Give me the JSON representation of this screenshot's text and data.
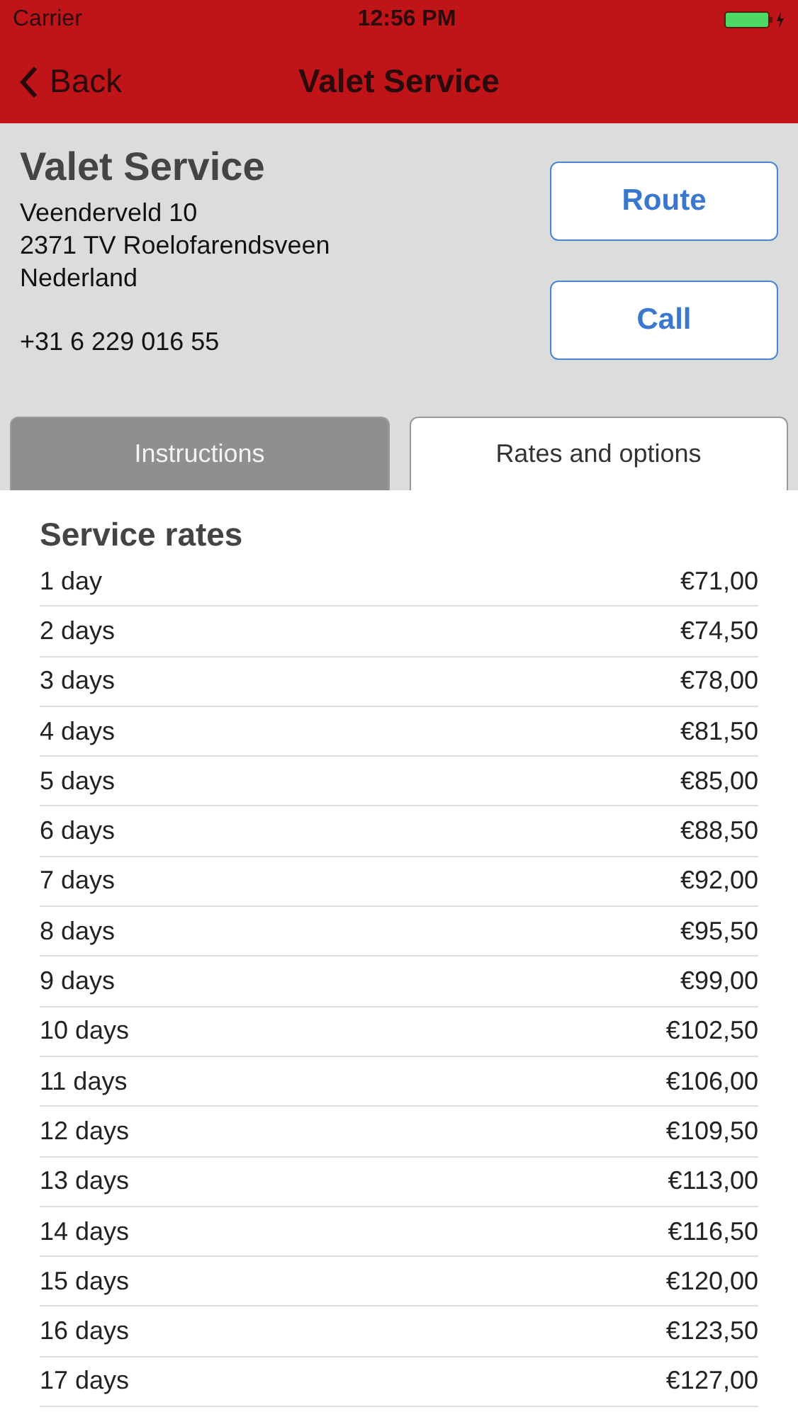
{
  "status_bar": {
    "carrier": "Carrier",
    "time": "12:56 PM"
  },
  "nav_bar": {
    "back": "Back",
    "title": "Valet Service"
  },
  "location": {
    "name": "Valet Service",
    "address": [
      "Veenderveld 10",
      "2371 TV Roelofarendsveen",
      "Nederland"
    ],
    "phone": "+31 6 229 016 55",
    "buttons": [
      "Route",
      "Call"
    ]
  },
  "tabs": [
    {
      "label": "Instructions",
      "selected": false
    },
    {
      "label": "Rates and options",
      "selected": true
    }
  ],
  "rates": {
    "title": "Service rates",
    "rows": [
      {
        "duration": "1 day",
        "price": "€71,00"
      },
      {
        "duration": "2 days",
        "price": "€74,50"
      },
      {
        "duration": "3 days",
        "price": "€78,00"
      },
      {
        "duration": "4 days",
        "price": "€81,50"
      },
      {
        "duration": "5 days",
        "price": "€85,00"
      },
      {
        "duration": "6 days",
        "price": "€88,50"
      },
      {
        "duration": "7 days",
        "price": "€92,00"
      },
      {
        "duration": "8 days",
        "price": "€95,50"
      },
      {
        "duration": "9 days",
        "price": "€99,00"
      },
      {
        "duration": "10 days",
        "price": "€102,50"
      },
      {
        "duration": "11 days",
        "price": "€106,00"
      },
      {
        "duration": "12 days",
        "price": "€109,50"
      },
      {
        "duration": "13 days",
        "price": "€113,00"
      },
      {
        "duration": "14 days",
        "price": "€116,50"
      },
      {
        "duration": "15 days",
        "price": "€120,00"
      },
      {
        "duration": "16 days",
        "price": "€123,50"
      },
      {
        "duration": "17 days",
        "price": "€127,00"
      }
    ]
  }
}
